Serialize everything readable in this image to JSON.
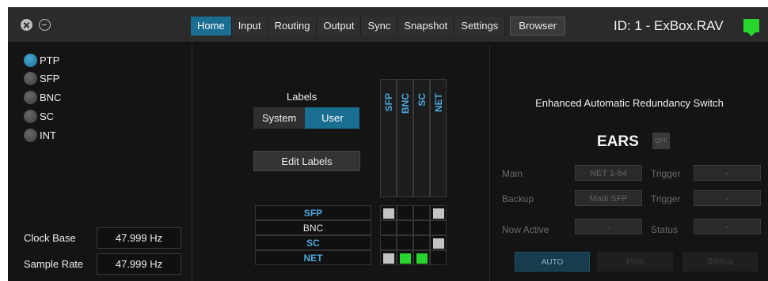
{
  "window_controls": {
    "close_icon": "close-circle-icon",
    "minimize_icon": "minimize-circle-icon"
  },
  "tabs": [
    {
      "label": "Home",
      "active": true
    },
    {
      "label": "Input",
      "active": false
    },
    {
      "label": "Routing",
      "active": false
    },
    {
      "label": "Output",
      "active": false
    },
    {
      "label": "Sync",
      "active": false
    },
    {
      "label": "Snapshot",
      "active": false
    },
    {
      "label": "Settings",
      "active": false
    },
    {
      "label": "Browser",
      "active": false
    }
  ],
  "device": {
    "id_text": "ID: 1 - ExBox.RAV",
    "status_color": "#27d52e"
  },
  "sync": {
    "sources": [
      {
        "label": "PTP",
        "selected": true
      },
      {
        "label": "SFP",
        "selected": false
      },
      {
        "label": "BNC",
        "selected": false
      },
      {
        "label": "SC",
        "selected": false
      },
      {
        "label": "INT",
        "selected": false
      }
    ],
    "clock_base_label": "Clock Base",
    "clock_base_value": "47.999 Hz",
    "sample_rate_label": "Sample Rate",
    "sample_rate_value": "47.999 Hz"
  },
  "labels": {
    "title": "Labels",
    "system_label": "System",
    "user_label": "User",
    "selected": "User",
    "edit_label": "Edit Labels"
  },
  "matrix": {
    "columns": [
      "SFP",
      "BNC",
      "SC",
      "NET"
    ],
    "rows": [
      {
        "label": "SFP",
        "color": "blue",
        "cells": [
          "grey",
          "",
          "",
          "grey"
        ]
      },
      {
        "label": "BNC",
        "color": "white",
        "cells": [
          "",
          "",
          "",
          ""
        ]
      },
      {
        "label": "SC",
        "color": "blue",
        "cells": [
          "",
          "",
          "",
          "grey"
        ]
      },
      {
        "label": "NET",
        "color": "blue",
        "cells": [
          "grey",
          "green",
          "green",
          ""
        ]
      }
    ]
  },
  "ears": {
    "title": "Enhanced Automatic Redundancy Switch",
    "label": "EARS",
    "toggle": "OFF",
    "main_label": "Main",
    "main_value": "NET 1-64",
    "backup_label": "Backup",
    "backup_value": "Madi SFP",
    "trigger_label": "Trigger",
    "trigger_main_value": "-",
    "trigger_backup_value": "-",
    "now_active_label": "Now Active",
    "now_active_value": "-",
    "status_label": "Status",
    "status_value": "-",
    "auto_label": "AUTO",
    "main_button_label": "Main",
    "backup_button_label": "Backup"
  }
}
